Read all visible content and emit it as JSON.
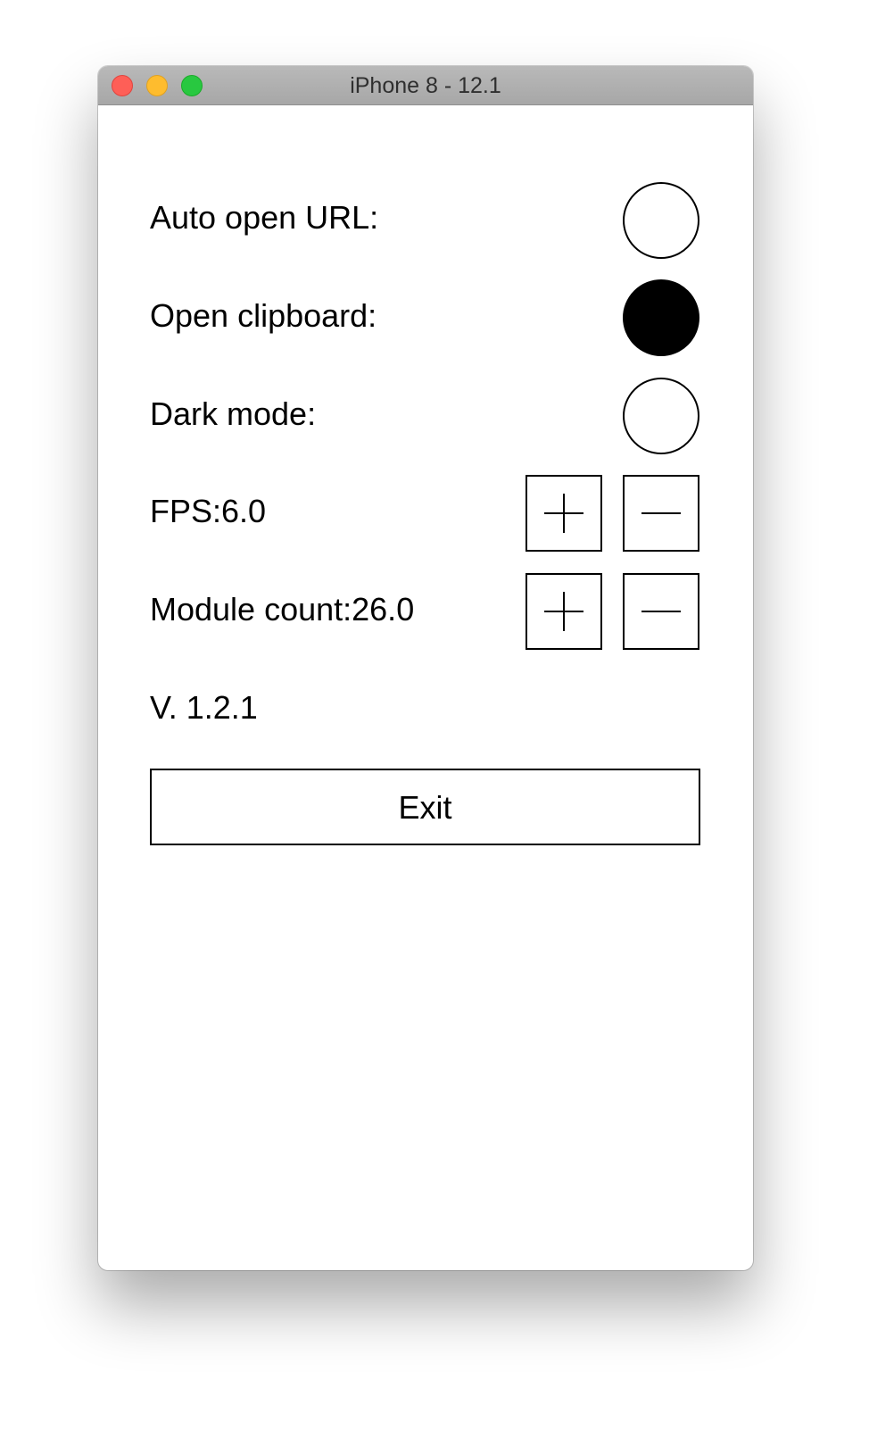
{
  "window": {
    "title": "iPhone 8 - 12.1"
  },
  "settings": {
    "auto_open_url": {
      "label": "Auto open URL:",
      "on": false
    },
    "open_clipboard": {
      "label": "Open clipboard:",
      "on": true
    },
    "dark_mode": {
      "label": "Dark mode:",
      "on": false
    }
  },
  "fps": {
    "label": "FPS:6.0",
    "increment_icon": "plus-icon",
    "decrement_icon": "minus-icon"
  },
  "module_count": {
    "label": "Module count:26.0",
    "increment_icon": "plus-icon",
    "decrement_icon": "minus-icon"
  },
  "version": "V. 1.2.1",
  "exit_label": "Exit",
  "colors": {
    "close": "#fe5f57",
    "minimize": "#febc2e",
    "maximize": "#28c840",
    "foreground": "#000000",
    "background": "#ffffff"
  }
}
